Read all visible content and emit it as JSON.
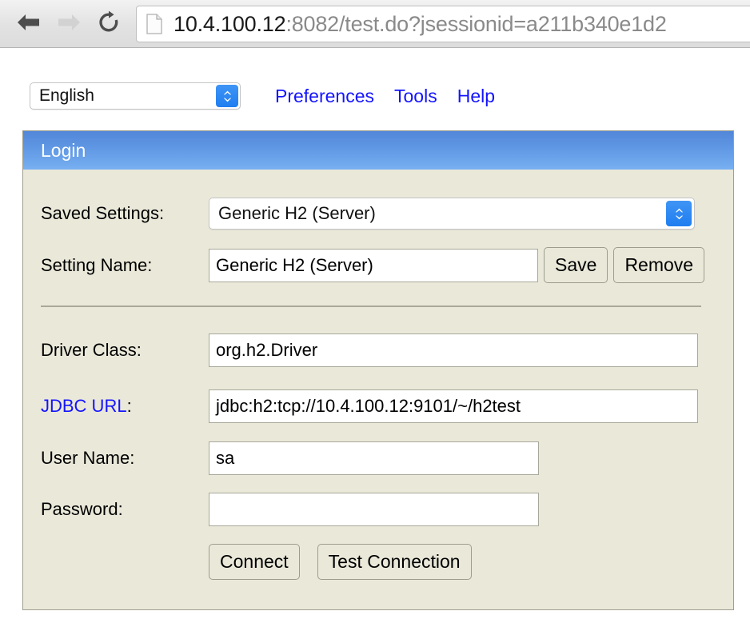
{
  "browser": {
    "back_icon": "back-arrow-icon",
    "forward_icon": "forward-arrow-icon",
    "reload_icon": "reload-icon",
    "page_icon": "document-icon",
    "url_host": "10.4.100.12",
    "url_rest": ":8082/test.do?jsessionid=a211b340e1d2"
  },
  "toolbar": {
    "language_select_value": "English",
    "language_options": [
      "English"
    ],
    "links": [
      {
        "label": "Preferences"
      },
      {
        "label": "Tools"
      },
      {
        "label": "Help"
      }
    ]
  },
  "login_panel": {
    "header_title": "Login",
    "fields": {
      "saved_settings_label": "Saved Settings:",
      "saved_settings_value": "Generic H2 (Server)",
      "saved_settings_options": [
        "Generic H2 (Server)"
      ],
      "setting_name_label": "Setting Name:",
      "setting_name_value": "Generic H2 (Server)",
      "driver_class_label": "Driver Class:",
      "driver_class_value": "org.h2.Driver",
      "jdbc_url_label": "JDBC URL",
      "jdbc_url_label_colon": ":",
      "jdbc_url_value": "jdbc:h2:tcp://10.4.100.12:9101/~/h2test",
      "user_name_label": "User Name:",
      "user_name_value": "sa",
      "password_label": "Password:",
      "password_value": "",
      "password_placeholder": ""
    },
    "buttons": {
      "save": "Save",
      "remove": "Remove",
      "connect": "Connect",
      "test_connection": "Test Connection"
    }
  },
  "colors": {
    "panel_bg": "#eae8d9",
    "panel_border": "#9f9f91",
    "header_gradient_top": "#5286d8",
    "header_gradient_bottom": "#78b0f2",
    "link_blue": "#1414ff",
    "select_accent": "#1f7df0"
  }
}
